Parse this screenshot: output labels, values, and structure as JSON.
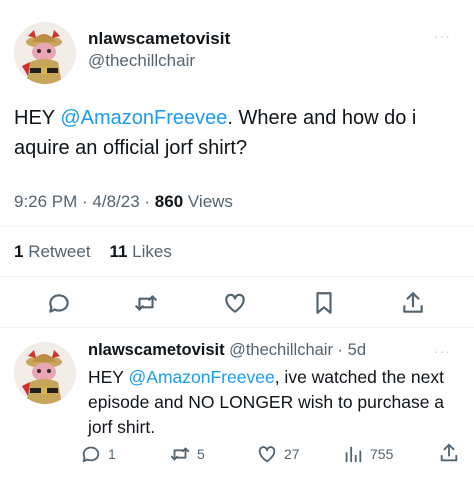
{
  "tweet": {
    "display_name": "nlawscametovisit",
    "handle": "@thechillchair",
    "more_label": "···",
    "text_parts": {
      "before": "HEY ",
      "mention": "@AmazonFreevee",
      "after": ".  Where and how do i aquire an official jorf shirt?"
    },
    "time": "9:26 PM",
    "sep1": " · ",
    "date": "4/8/23",
    "sep2": " · ",
    "views_count": "860",
    "views_label": " Views",
    "retweets_count": "1",
    "retweets_label": " Retweet",
    "likes_count": "11",
    "likes_label": " Likes",
    "actions": [
      "reply-icon",
      "retweet-icon",
      "like-icon",
      "bookmark-icon",
      "share-icon"
    ]
  },
  "reply": {
    "display_name": "nlawscametovisit",
    "handle": "@thechillchair",
    "sep": " · ",
    "age": "5d",
    "more_label": "···",
    "text_parts": {
      "before": "HEY ",
      "mention": "@AmazonFreevee",
      "after": ", ive watched the next episode and NO LONGER wish to purchase a jorf shirt."
    },
    "reply_count": "1",
    "retweet_count": "5",
    "like_count": "27",
    "view_count": "755"
  },
  "colors": {
    "accent": "#1d9bf0",
    "text": "#0f1419",
    "secondary": "#536471",
    "divider": "#eff3f4"
  }
}
